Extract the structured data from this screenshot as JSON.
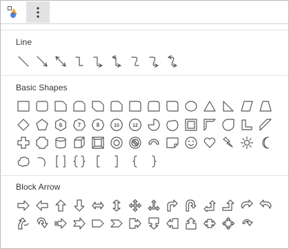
{
  "toolbar": {
    "shapes_icon": "shapes-icon",
    "more_icon": "more-vertical-icon"
  },
  "sections": [
    {
      "title": "Line",
      "shapes": [
        "line",
        "arrow-line",
        "double-arrow-line",
        "elbow-connector",
        "elbow-arrow",
        "elbow-double-arrow",
        "curved-connector",
        "curved-arrow",
        "curved-double-arrow"
      ]
    },
    {
      "title": "Basic Shapes",
      "shapes": [
        "rectangle",
        "rounded-rectangle",
        "snip-corner-rectangle",
        "snip-same-side-rectangle",
        "snip-diagonal-rectangle",
        "snip-round-rectangle",
        "round-corner-rectangle",
        "round-same-side-rectangle",
        "round-diagonal-rectangle",
        "oval",
        "triangle",
        "right-triangle",
        "parallelogram",
        "trapezoid",
        "diamond",
        "pentagon",
        "hexagon",
        "heptagon",
        "octagon",
        "decagon",
        "dodecagon",
        "pie",
        "chord",
        "frame",
        "half-frame",
        "teardrop",
        "l-shape",
        "diagonal-stripe",
        "cross",
        "plaque",
        "can",
        "cube",
        "bevel",
        "donut",
        "no-symbol",
        "block-arc",
        "folded-corner",
        "smiley-face",
        "heart",
        "lightning-bolt",
        "sun",
        "moon",
        "cloud",
        "arc",
        "double-bracket",
        "double-brace",
        "left-bracket",
        "right-bracket",
        "left-brace",
        "right-brace"
      ],
      "polygon_labels": {
        "hexagon": "6",
        "heptagon": "7",
        "octagon": "8",
        "decagon": "10",
        "dodecagon": "12"
      }
    },
    {
      "title": "Block Arrow",
      "shapes": [
        "right-arrow",
        "left-arrow",
        "up-arrow",
        "down-arrow",
        "left-right-arrow",
        "up-down-arrow",
        "quad-arrow",
        "left-right-up-arrow",
        "bent-arrow",
        "u-turn-arrow",
        "left-up-arrow",
        "bent-up-arrow",
        "curved-right-arrow",
        "curved-left-arrow",
        "curved-up-arrow",
        "curved-down-arrow",
        "striped-right-arrow",
        "notched-right-arrow",
        "pentagon-arrow",
        "chevron",
        "right-arrow-callout",
        "down-arrow-callout",
        "left-arrow-callout",
        "up-arrow-callout",
        "left-right-arrow-callout",
        "quad-arrow-callout",
        "circular-arrow"
      ]
    }
  ],
  "colors": {
    "stroke": "#555555",
    "icon_orange": "#f0a030",
    "icon_blue": "#3a7bd5",
    "toolbar_active": "#e2e2e2"
  }
}
